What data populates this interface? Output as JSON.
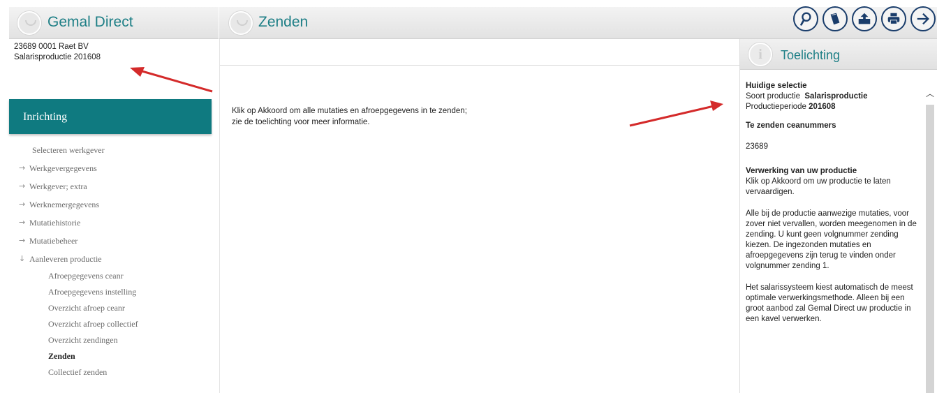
{
  "app": {
    "title": "Gemal Direct",
    "page_title": "Zenden"
  },
  "toolbar": {
    "buttons": [
      {
        "icon": "search-icon"
      },
      {
        "icon": "book-icon"
      },
      {
        "icon": "upload-icon"
      },
      {
        "icon": "print-icon"
      },
      {
        "icon": "arrow-right-icon"
      }
    ]
  },
  "left": {
    "company_line": "23689 0001 Raet BV",
    "production_line": "Salarisproductie  201608",
    "section_title": "Inrichting",
    "nav": [
      {
        "label": "Selecteren werkgever",
        "arrow": ""
      },
      {
        "label": "Werkgevergegevens",
        "arrow": "→"
      },
      {
        "label": "Werkgever; extra",
        "arrow": "→"
      },
      {
        "label": "Werknemergegevens",
        "arrow": "→"
      },
      {
        "label": "Mutatiehistorie",
        "arrow": "→"
      },
      {
        "label": "Mutatiebeheer",
        "arrow": "→"
      },
      {
        "label": "Aanleveren productie",
        "arrow": "↓"
      }
    ],
    "sub_items": [
      "Afroepgegevens ceanr",
      "Afroepgegevens instelling",
      "Overzicht afroep ceanr",
      "Overzicht afroep collectief",
      "Overzicht zendingen",
      "Zenden",
      "Collectief zenden"
    ]
  },
  "main": {
    "line1": "Klik op Akkoord om alle mutaties en afroepgegevens in te zenden;",
    "line2": "zie de toelichting voor meer informatie."
  },
  "explanation": {
    "title": "Toelichting",
    "current_selection_heading": "Huidige selectie",
    "product_type_label": "Soort productie",
    "product_type_value": "Salarisproductie",
    "period_label": "Productieperiode",
    "period_value": "201608",
    "send_heading": "Te zenden ceanummers",
    "ceanumber": "23689",
    "processing_heading": "Verwerking van uw productie",
    "processing_text": "Klik op Akkoord om uw productie te laten vervaardigen.",
    "paragraph2": "Alle bij de productie aanwezige mutaties, voor zover niet vervallen, worden meegenomen in de zending. U kunt geen volgnummer zending kiezen. De ingezonden mutaties en afroepgegevens zijn terug te vinden onder volgnummer zending 1.",
    "paragraph3": "Het salarissysteem kiest automatisch de meest optimale verwerkingsmethode. Alleen bij een groot aanbod zal Gemal Direct uw productie in een kavel verwerken."
  },
  "colors": {
    "accent_teal": "#0f7a80",
    "title_teal": "#1e7f86",
    "toolbar_navy": "#1a3d6b",
    "annotation_red": "#d42a2a"
  }
}
